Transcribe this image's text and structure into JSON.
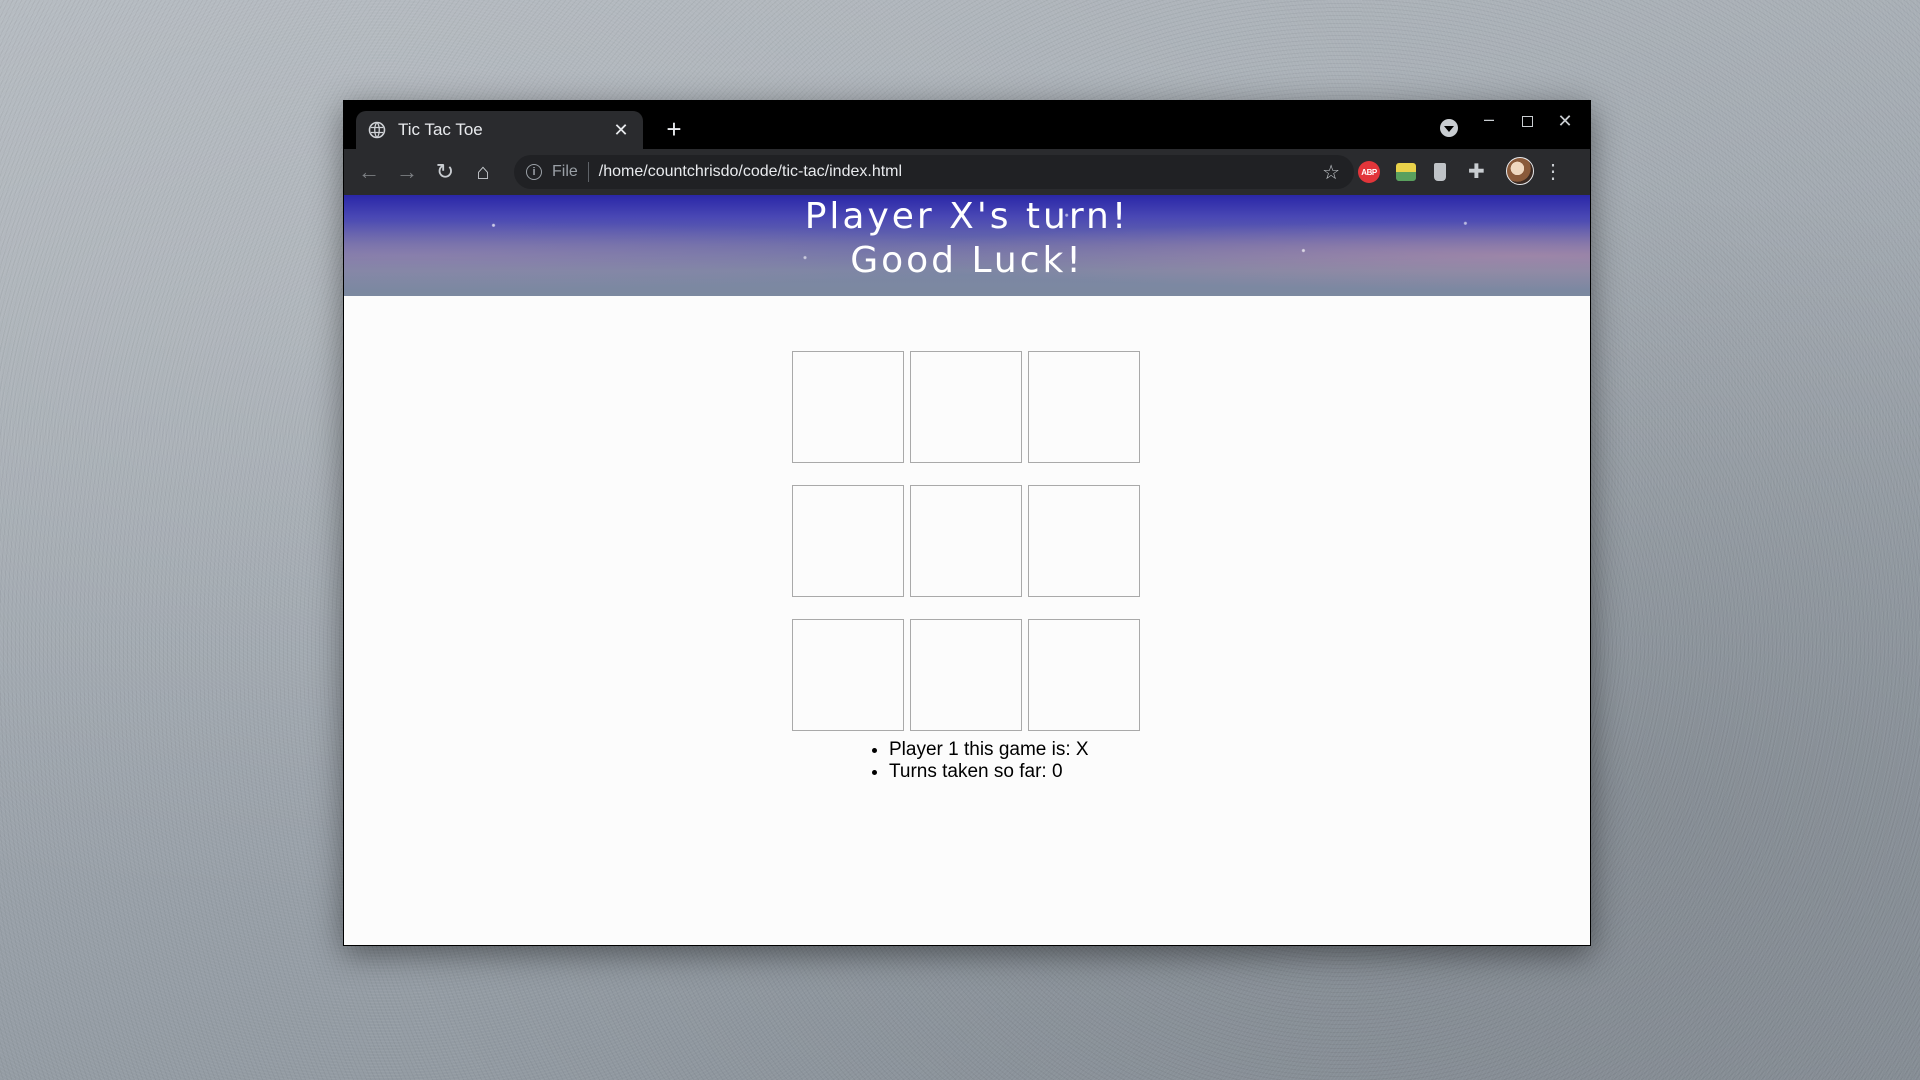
{
  "browser": {
    "tab": {
      "title": "Tic Tac Toe",
      "close": "✕"
    },
    "new_tab": "+",
    "window_controls": {
      "minimize": "–",
      "close": "✕"
    },
    "toolbar": {
      "back": "←",
      "forward": "→",
      "reload": "↻",
      "home": "⌂",
      "scheme_label": "File",
      "url": "/home/countchrisdo/code/tic-tac/index.html",
      "star": "☆",
      "abp_label": "ABP",
      "extensions": "✚",
      "menu": "⋮"
    }
  },
  "page": {
    "header": {
      "line1": "Player X's turn!",
      "line2": "Good Luck!"
    },
    "board": {
      "cells": [
        "",
        "",
        "",
        "",
        "",
        "",
        "",
        "",
        ""
      ]
    },
    "info": {
      "player1": "Player 1 this game is: X",
      "turns": "Turns taken so far: 0"
    }
  },
  "colors": {
    "header_top": "#2a27a8",
    "header_bottom": "#7c89a0",
    "cell_border": "#a9a9a9",
    "page_background": "#fcfcfc"
  }
}
